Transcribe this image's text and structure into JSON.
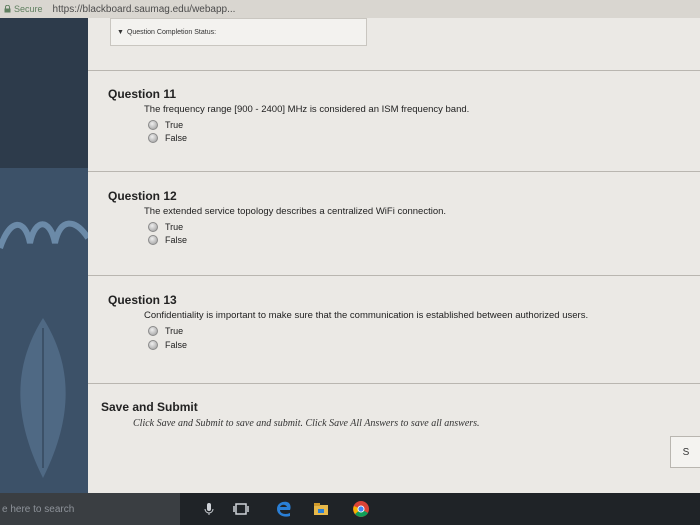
{
  "browser": {
    "secure_label": "Secure",
    "url": "https://blackboard.saumag.edu/webapp..."
  },
  "status": {
    "label": "Question Completion Status:"
  },
  "questions": [
    {
      "title": "Question 11",
      "text": "The frequency range [900 - 2400] MHz is considered an ISM frequency band.",
      "options": [
        "True",
        "False"
      ]
    },
    {
      "title": "Question 12",
      "text": "The extended service topology describes a centralized WiFi connection.",
      "options": [
        "True",
        "False"
      ]
    },
    {
      "title": "Question 13",
      "text": "Confidentiality is important to make sure that the communication is established between authorized users.",
      "options": [
        "True",
        "False"
      ]
    }
  ],
  "save_submit": {
    "title": "Save and Submit",
    "instructions": "Click Save and Submit to save and submit. Click Save All Answers to save all answers.",
    "side_button_label": "S"
  },
  "taskbar": {
    "search_placeholder": "e here to search"
  }
}
